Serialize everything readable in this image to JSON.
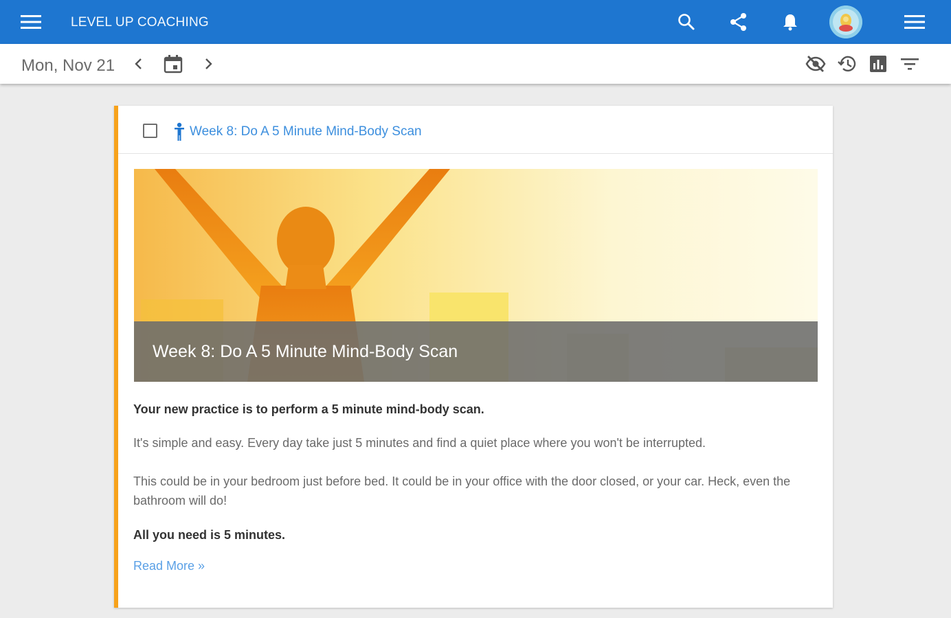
{
  "appbar": {
    "title": "LEVEL UP COACHING",
    "icons": [
      "menu-icon",
      "search-icon",
      "share-icon",
      "bell-icon",
      "avatar",
      "overflow-menu-icon"
    ],
    "color": "#1e76d0"
  },
  "toolbar": {
    "date": "Mon, Nov 21",
    "icons": [
      "chevron-left-icon",
      "calendar-icon",
      "chevron-right-icon",
      "visibility-off-icon",
      "history-icon",
      "chart-icon",
      "filter-icon"
    ]
  },
  "card": {
    "accent_color": "#f7a21b",
    "header_title": "Week 8: Do A 5 Minute Mind-Body Scan",
    "hero_caption": "Week 8: Do A 5 Minute Mind-Body Scan",
    "paragraphs": [
      "Your new practice is to perform a 5 minute mind-body scan.",
      "It's simple and easy. Every day take just 5 minutes and find a quiet place where you won't be interrupted.",
      "This could be in your bedroom just before bed. It could be in your office with the door closed, or your car. Heck, even the bathroom will do!",
      "All you need is 5 minutes."
    ],
    "read_more": "Read More »"
  }
}
